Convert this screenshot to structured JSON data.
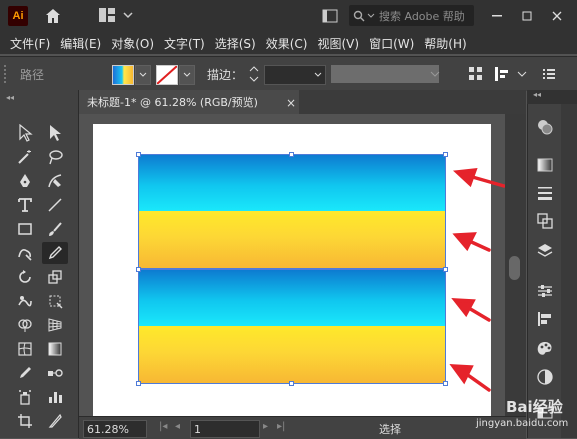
{
  "app": {
    "logo_text": "Ai",
    "search_placeholder": "搜索 Adobe 帮助"
  },
  "menu": {
    "items": [
      "文件(F)",
      "编辑(E)",
      "对象(O)",
      "文字(T)",
      "选择(S)",
      "效果(C)",
      "视图(V)",
      "窗口(W)",
      "帮助(H)"
    ]
  },
  "control_bar": {
    "object_label": "路径",
    "stroke_label": "描边：",
    "fill_type": "gradient",
    "stroke_type": "none"
  },
  "document": {
    "tab_title": "未标题-1* @ 61.28% (RGB/预览)",
    "close_glyph": "×"
  },
  "artwork": {
    "top_gradient_colors": [
      "#0d79cf",
      "#10c6ef",
      "#1ae8fb"
    ],
    "bottom_gradient_colors": [
      "#ffe92a",
      "#fdd735",
      "#f7b734"
    ],
    "selection_color": "#4f7bd8",
    "annotation_arrow_color": "#e5232b",
    "annotation_arrow_count": 4
  },
  "status": {
    "zoom": "61.28%",
    "page": "1",
    "tool": "选择"
  },
  "watermark": {
    "line1": "Bai经验",
    "line2": "jingyan.baidu.com"
  },
  "icons": {
    "toolbar": [
      "selection-tool-icon",
      "direct-selection-tool-icon",
      "magic-wand-tool-icon",
      "lasso-tool-icon",
      "pen-tool-icon",
      "curvature-tool-icon",
      "type-tool-icon",
      "line-segment-tool-icon",
      "rectangle-tool-icon",
      "paintbrush-tool-icon",
      "shaper-tool-icon",
      "eyedropper-tool-icon",
      "rotate-tool-icon",
      "scale-tool-icon",
      "warp-tool-icon",
      "free-transform-tool-icon",
      "shape-builder-tool-icon",
      "perspective-grid-tool-icon",
      "mesh-tool-icon",
      "gradient-tool-icon",
      "eyedropper2-tool-icon",
      "blend-tool-icon",
      "symbol-sprayer-tool-icon",
      "column-graph-tool-icon",
      "artboard-tool-icon",
      "slice-tool-icon"
    ],
    "panels": [
      "appearance-panel-icon",
      "gradient-panel-icon",
      "stroke-panel-icon",
      "transform-panel-icon",
      "layers-panel-icon",
      "properties-panel-icon",
      "align-panel-icon",
      "color-panel-icon",
      "transparency-panel-icon",
      "color-guide-panel-icon"
    ]
  }
}
